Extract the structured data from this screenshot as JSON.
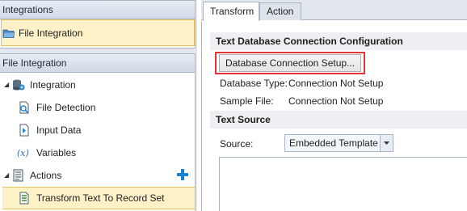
{
  "left": {
    "integrations_header": "Integrations",
    "integrations_item": "File Integration",
    "file_integration_header": "File Integration",
    "tree": {
      "integration": "Integration",
      "file_detection": "File Detection",
      "input_data": "Input Data",
      "variables": "Variables",
      "actions": "Actions",
      "transform": "Transform Text To Record Set"
    }
  },
  "right": {
    "tabs": [
      "Transform",
      "Action"
    ],
    "section_config": "Text Database Connection Configuration",
    "setup_button": "Database Connection Setup...",
    "db_type_label": "Database Type:",
    "db_type_value": "Connection Not Setup",
    "sample_file_label": "Sample File:",
    "sample_file_value": "Connection Not Setup",
    "section_source": "Text Source",
    "source_label": "Source:",
    "source_value": "Embedded Template"
  },
  "colors": {
    "selection_fill": "#fdf1c8",
    "selection_border": "#e6c25c",
    "highlight_border": "#e0333a",
    "add_icon": "#1c7fd2"
  }
}
